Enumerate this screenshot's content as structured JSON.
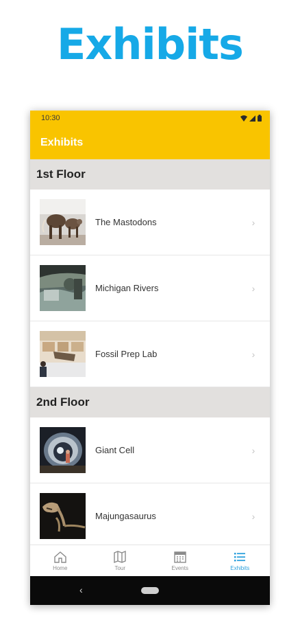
{
  "promo": {
    "title": "Exhibits"
  },
  "status_bar": {
    "time": "10:30"
  },
  "app_bar": {
    "title": "Exhibits"
  },
  "sections": [
    {
      "title": "1st Floor",
      "items": [
        {
          "label": "The Mastodons",
          "image": "mastodon-skeleton-photo"
        },
        {
          "label": "Michigan Rivers",
          "image": "river-diorama-photo"
        },
        {
          "label": "Fossil Prep Lab",
          "image": "fossil-lab-photo"
        }
      ]
    },
    {
      "title": "2nd Floor",
      "items": [
        {
          "label": "Giant Cell",
          "image": "giant-cell-photo"
        },
        {
          "label": "Majungasaurus",
          "image": "dinosaur-skeleton-photo"
        }
      ]
    }
  ],
  "bottom_nav": [
    {
      "label": "Home",
      "icon": "home-icon",
      "active": false
    },
    {
      "label": "Tour",
      "icon": "map-icon",
      "active": false
    },
    {
      "label": "Events",
      "icon": "calendar-icon",
      "active": false
    },
    {
      "label": "Exhibits",
      "icon": "list-icon",
      "active": true
    }
  ],
  "colors": {
    "accent_yellow": "#f9c400",
    "promo_blue": "#16a9e7",
    "active_nav": "#2a9fdc",
    "section_bg": "#e2e0de"
  }
}
